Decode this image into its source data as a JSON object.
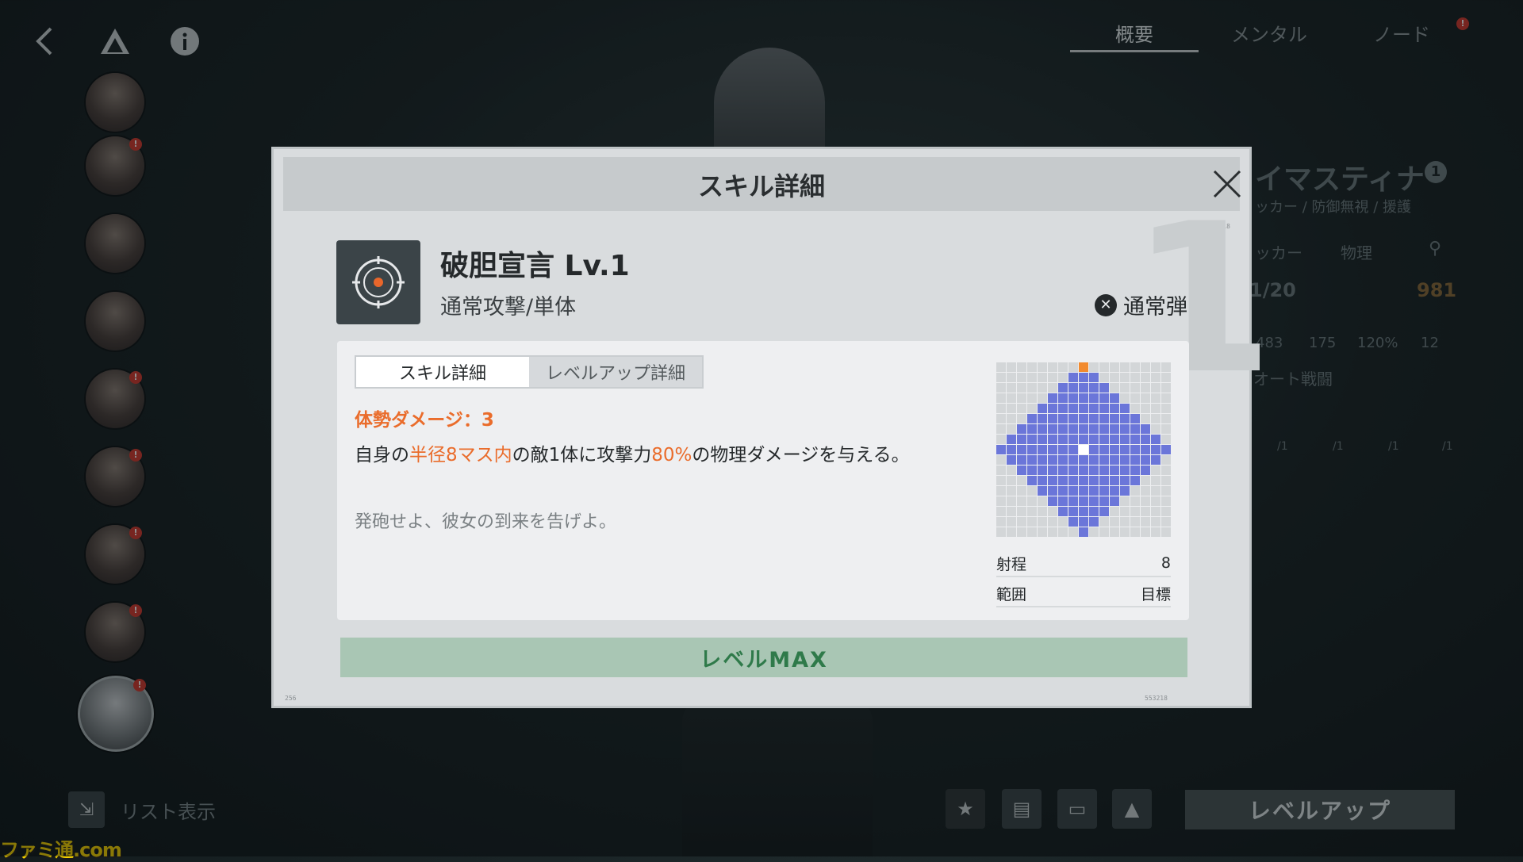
{
  "top_nav": {
    "tabs": [
      "概要",
      "メンタル",
      "ノード"
    ],
    "active_tab": 0
  },
  "sidebar": {
    "avatar_count": 9,
    "alert_mark": "!",
    "list_view_label": "リスト表示"
  },
  "background_panel": {
    "character_name": "イマスティナ",
    "name_badge": "1",
    "roles": "ッカー / 防御無視 / 援護",
    "class_tags": [
      "ッカー",
      "物理"
    ],
    "level": "1/20",
    "power": "981",
    "stats": [
      "483",
      "175",
      "120%",
      "12"
    ],
    "auto_battle": "オート戦闘",
    "skill_levels": [
      "/1",
      "/1",
      "/1",
      "/1"
    ],
    "level_up_button": "レベルアップ"
  },
  "modal": {
    "title": "スキル詳細",
    "big_number": "1",
    "skill_name": "破胆宣言 Lv.1",
    "skill_type": "通常攻撃/単体",
    "ammo_type": "通常弾",
    "subtabs": [
      "スキル詳細",
      "レベルアップ詳細"
    ],
    "active_subtab": 0,
    "posture_damage": "体勢ダメージ：3",
    "description": {
      "part1": "自身の",
      "highlight1": "半径8マス内",
      "part2": "の敵1体に攻撃力",
      "highlight2": "80%",
      "part3": "の物理ダメージを与える。"
    },
    "flavor": "発砲せよ、彼女の到来を告げよ。",
    "range_grid": {
      "size": 15,
      "radius": 8,
      "range_color": "#6b76d9",
      "center_color": "#ffffff",
      "marker_color": "#f28a2e"
    },
    "stats": [
      {
        "label": "射程",
        "value": "8"
      },
      {
        "label": "範囲",
        "value": "目標"
      }
    ],
    "level_max_label": "レベルMAX"
  },
  "colors": {
    "highlight": "#ea6c2b",
    "level_max_bg": "#a9c6b4",
    "level_max_text": "#2f7a4a",
    "alert": "#d23a2e"
  }
}
